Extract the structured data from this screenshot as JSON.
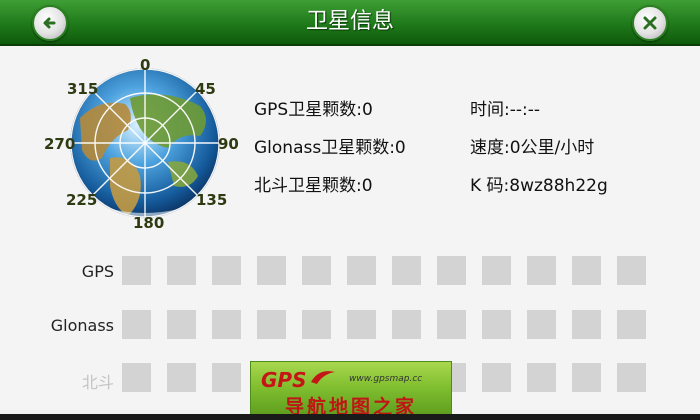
{
  "header": {
    "title": "卫星信息",
    "back_icon": "back-arrow-icon",
    "close_icon": "close-x-icon",
    "accent": "#1f7a1a"
  },
  "globe": {
    "degree_labels": [
      "0",
      "45",
      "90",
      "135",
      "180",
      "225",
      "270",
      "315"
    ]
  },
  "info": {
    "gps_count": "GPS卫星颗数:0",
    "glonass_count": "Glonass卫星颗数:0",
    "beidou_count": "北斗卫星颗数:0",
    "time": "时间:--:--",
    "speed": "速度:0公里/小时",
    "k_code": "K 码:8wz88h22g"
  },
  "signal_rows": {
    "gps_label": "GPS",
    "glonass_label": "Glonass",
    "beidou_label": "北斗",
    "cells_per_row": 12
  },
  "banner": {
    "logo_text": "GPS",
    "url": "www.gpsmap.cc",
    "slogan": "导航地图之家"
  }
}
